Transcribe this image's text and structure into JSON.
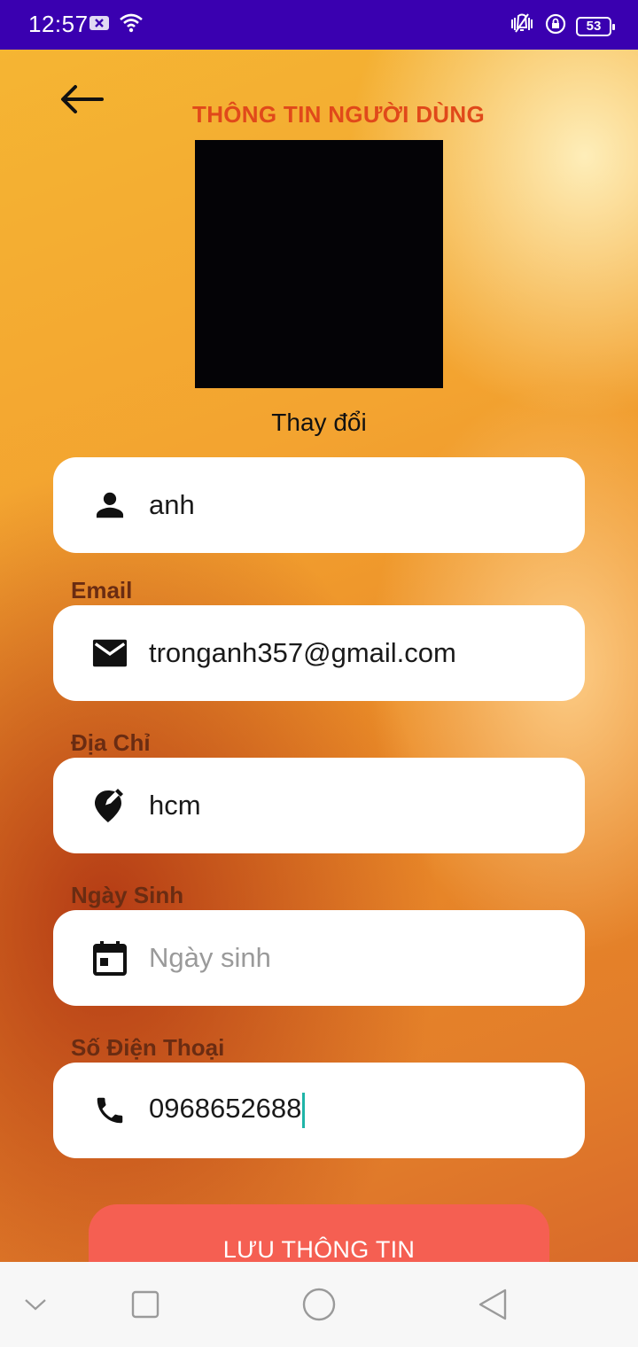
{
  "status_bar": {
    "time": "12:57",
    "battery": "53"
  },
  "header": {
    "title": "THÔNG TIN NGƯỜI DÙNG"
  },
  "avatar": {
    "change_label": "Thay đổi"
  },
  "form": {
    "name": {
      "icon": "person-icon",
      "value": "anh"
    },
    "email": {
      "label": "Email",
      "icon": "mail-icon",
      "value": "tronganh357@gmail.com"
    },
    "address": {
      "label": "Địa Chỉ",
      "icon": "edit-location-icon",
      "value": "hcm"
    },
    "birthday": {
      "label": "Ngày Sinh",
      "icon": "calendar-icon",
      "value": "",
      "placeholder": "Ngày sinh"
    },
    "phone": {
      "label": "Số Điện Thoại",
      "icon": "phone-icon",
      "value": "0968652688"
    }
  },
  "actions": {
    "save_label": "LƯU THÔNG TIN"
  },
  "colors": {
    "title": "#e0491a",
    "label": "#6a2c12",
    "button": "#f55f52",
    "status_bar": "#3a00b0",
    "cursor": "#1fb5a8"
  }
}
